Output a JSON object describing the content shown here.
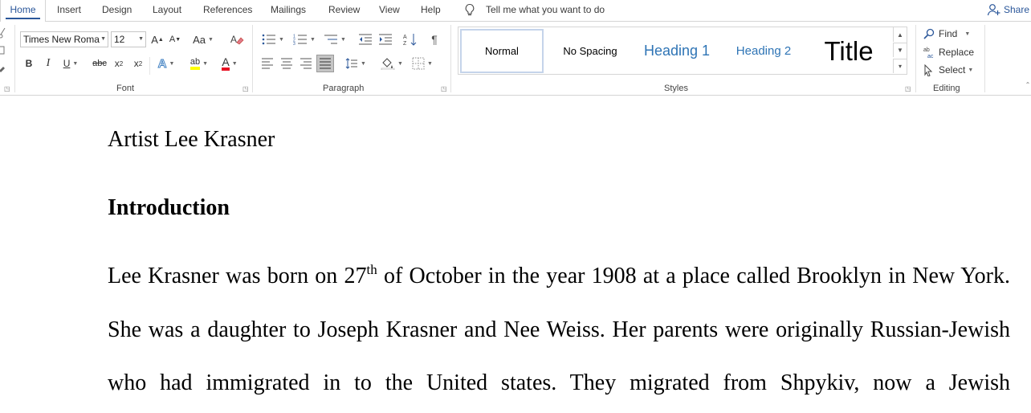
{
  "tabs": [
    {
      "label": "Home",
      "active": true
    },
    {
      "label": "Insert"
    },
    {
      "label": "Design"
    },
    {
      "label": "Layout"
    },
    {
      "label": "References"
    },
    {
      "label": "Mailings"
    },
    {
      "label": "Review"
    },
    {
      "label": "View"
    },
    {
      "label": "Help"
    }
  ],
  "tell_me": "Tell me what you want to do",
  "share": "Share",
  "font": {
    "name": "Times New Roma",
    "size": "12",
    "group_label": "Font",
    "grow_label": "A",
    "shrink_label": "A",
    "case_label": "Aa",
    "bold": "B",
    "italic": "I",
    "underline": "U",
    "strike": "abc",
    "subscript": "x",
    "subscript_mark": "2",
    "superscript": "x",
    "superscript_mark": "2",
    "effects": "A",
    "highlight": "ab",
    "color": "A",
    "highlight_color": "#ffff00",
    "font_color": "#e81123"
  },
  "paragraph": {
    "group_label": "Paragraph"
  },
  "styles": {
    "group_label": "Styles",
    "items": [
      {
        "label": "Normal",
        "selected": true
      },
      {
        "label": "No Spacing"
      },
      {
        "label": "Heading 1"
      },
      {
        "label": "Heading 2"
      },
      {
        "label": "Title"
      }
    ]
  },
  "editing": {
    "group_label": "Editing",
    "find": "Find",
    "replace": "Replace",
    "select": "Select"
  },
  "document": {
    "title": "Artist Lee Krasner",
    "heading": "Introduction",
    "line1_a": "Lee Krasner was born on 27",
    "line1_sup": "th",
    "line1_b": " of October in the year 1908 at a place called Brooklyn in New York.",
    "line2": "She was a daughter to Joseph Krasner and Nee Weiss. Her parents were originally Russian-Jewish",
    "line3": "who had immigrated in to the United states. They migrated from Shpykiv, now a Jewish"
  },
  "accent": "#2b579a"
}
